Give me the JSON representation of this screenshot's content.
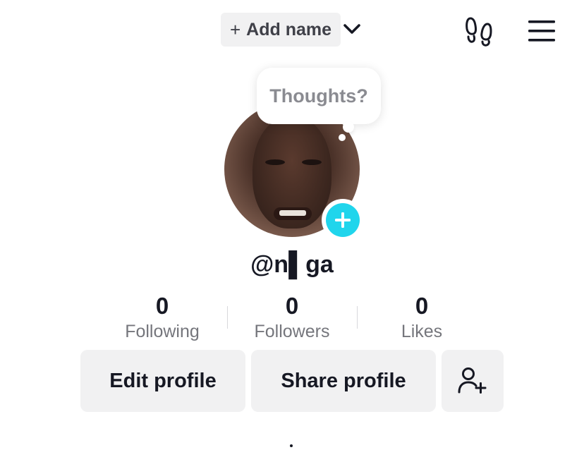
{
  "header": {
    "add_name_plus": "+",
    "add_name_label": "Add name"
  },
  "thought_bubble": {
    "text": "Thoughts?"
  },
  "profile": {
    "username": "@n▌ga"
  },
  "stats": [
    {
      "value": "0",
      "label": "Following"
    },
    {
      "value": "0",
      "label": "Followers"
    },
    {
      "value": "0",
      "label": "Likes"
    }
  ],
  "actions": {
    "edit_profile": "Edit profile",
    "share_profile": "Share profile"
  },
  "icons": {
    "chevron": "chevron-down-icon",
    "footprint": "footprint-icon",
    "menu": "hamburger-menu-icon",
    "avatar_add": "plus-circle-icon",
    "add_friend": "add-user-icon"
  },
  "colors": {
    "accent": "#20d5ec",
    "button_bg": "#f1f1f2",
    "text_primary": "#161823",
    "text_secondary": "#75767c"
  }
}
